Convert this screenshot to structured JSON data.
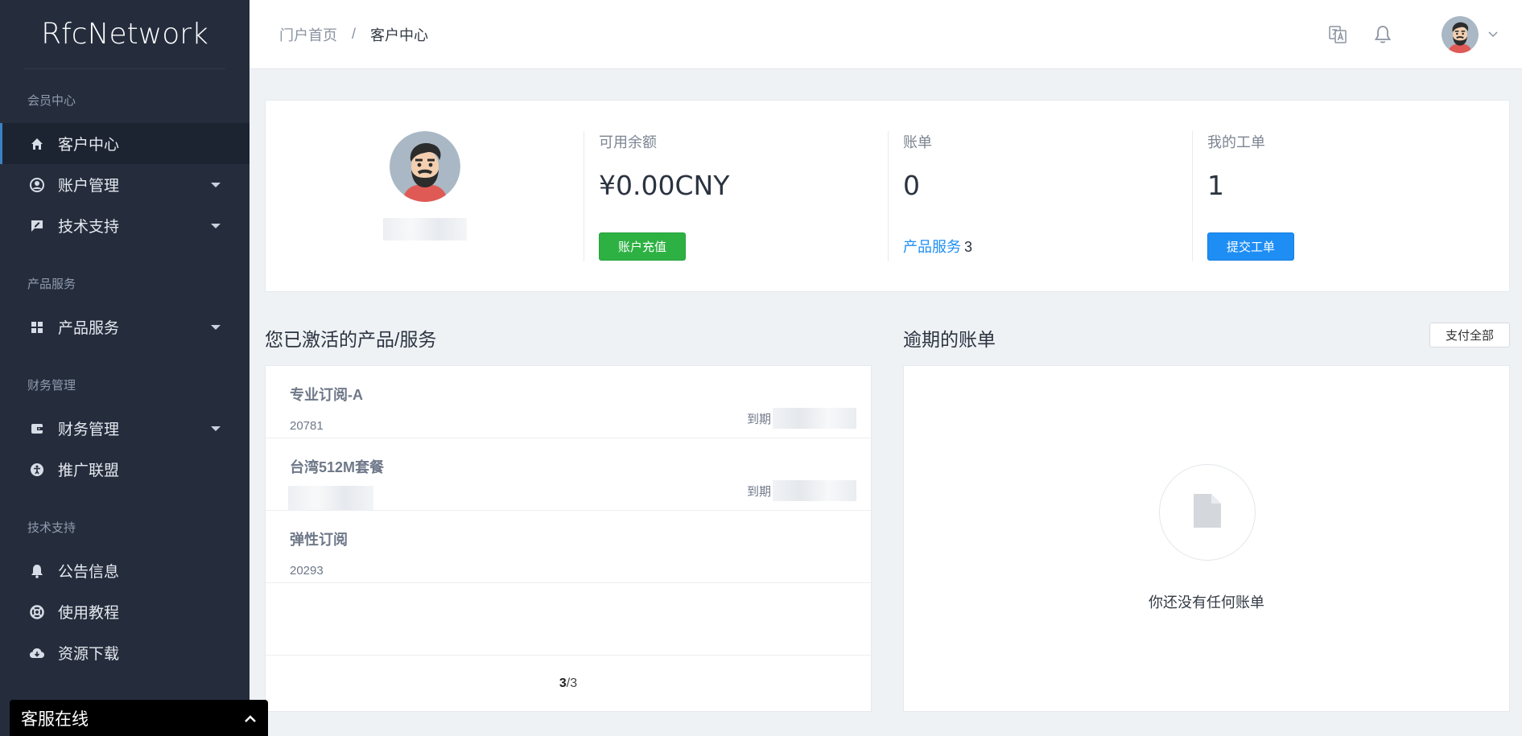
{
  "brand": "RfcNetwork",
  "sidebar": {
    "sections": [
      {
        "title": "会员中心",
        "items": [
          {
            "label": "客户中心",
            "icon": "home-icon",
            "active": true,
            "dropdown": false
          },
          {
            "label": "账户管理",
            "icon": "user-circle-icon",
            "active": false,
            "dropdown": true
          },
          {
            "label": "技术支持",
            "icon": "chat-edit-icon",
            "active": false,
            "dropdown": true
          }
        ]
      },
      {
        "title": "产品服务",
        "items": [
          {
            "label": "产品服务",
            "icon": "grid-icon",
            "active": false,
            "dropdown": true
          }
        ]
      },
      {
        "title": "财务管理",
        "items": [
          {
            "label": "财务管理",
            "icon": "wallet-icon",
            "active": false,
            "dropdown": true
          },
          {
            "label": "推广联盟",
            "icon": "accessibility-icon",
            "active": false,
            "dropdown": false
          }
        ]
      },
      {
        "title": "技术支持",
        "items": [
          {
            "label": "公告信息",
            "icon": "bell-icon",
            "active": false,
            "dropdown": false
          },
          {
            "label": "使用教程",
            "icon": "lifebuoy-icon",
            "active": false,
            "dropdown": false
          },
          {
            "label": "资源下载",
            "icon": "cloud-download-icon",
            "active": false,
            "dropdown": false
          }
        ]
      }
    ]
  },
  "chat": {
    "label": "客服在线"
  },
  "header": {
    "breadcrumb": {
      "home": "门户首页",
      "separator": "/",
      "current": "客户中心"
    }
  },
  "stats": {
    "balance": {
      "label": "可用余额",
      "value": "¥0.00CNY",
      "button": "账户充值"
    },
    "bills": {
      "label": "账单",
      "value": "0",
      "link": "产品服务",
      "link_count": "3"
    },
    "tickets": {
      "label": "我的工单",
      "value": "1",
      "button": "提交工单"
    }
  },
  "products": {
    "title": "您已激活的产品/服务",
    "expire_label": "到期",
    "items": [
      {
        "name": "专业订阅-A",
        "id": "20781",
        "show_expire": true
      },
      {
        "name": "台湾512M套餐",
        "id": "",
        "show_expire": true
      },
      {
        "name": "弹性订阅",
        "id": "20293",
        "show_expire": false
      }
    ],
    "pager": {
      "current": "3",
      "total": "/3"
    }
  },
  "overdue": {
    "title": "逾期的账单",
    "pay_all": "支付全部",
    "empty_text": "你还没有任何账单"
  },
  "colors": {
    "sidebar_bg": "#252d3d",
    "accent_blue": "#1e8ef5",
    "accent_green": "#2eb143"
  }
}
